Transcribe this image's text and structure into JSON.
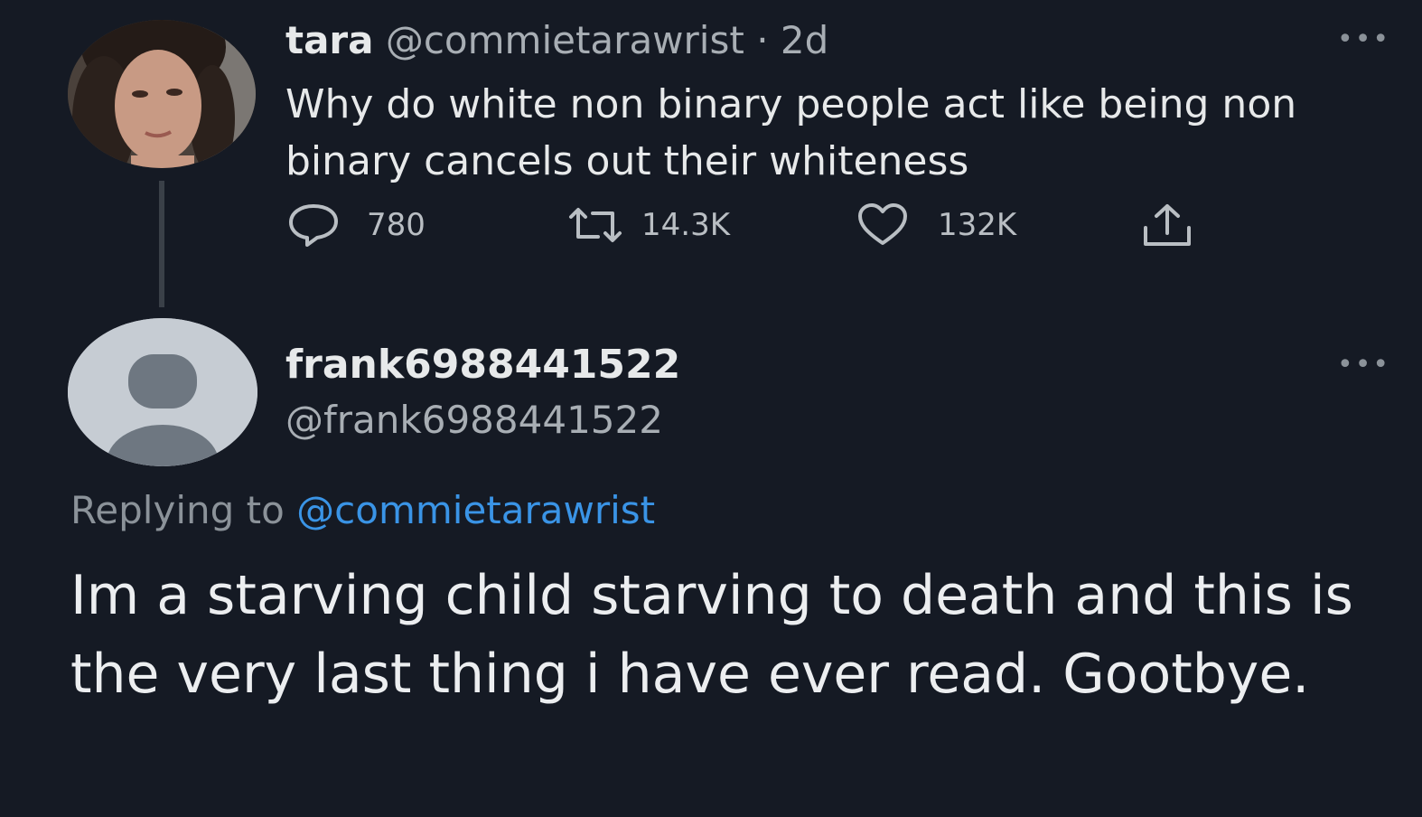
{
  "tweet": {
    "display_name": "tara",
    "handle": "@commietarawrist",
    "separator": "·",
    "time": "2d",
    "text": "Why do white non binary people act like being non binary cancels out their whiteness",
    "more_label": "•••",
    "stats": {
      "replies": "780",
      "retweets": "14.3K",
      "likes": "132K"
    },
    "icons": [
      "reply-icon",
      "retweet-icon",
      "like-icon",
      "share-icon"
    ]
  },
  "reply": {
    "display_name": "frank6988441522",
    "handle": "@frank6988441522",
    "more_label": "•••",
    "replying_prefix": "Replying to",
    "replying_handle": "@commietarawrist",
    "text": "Im a starving child starving to death and this is the very last thing i have ever read. Gootbye."
  },
  "colors": {
    "background": "#151a24",
    "text": "#e7e9ea",
    "muted": "#a8aeb4",
    "link": "#3a94e6"
  }
}
